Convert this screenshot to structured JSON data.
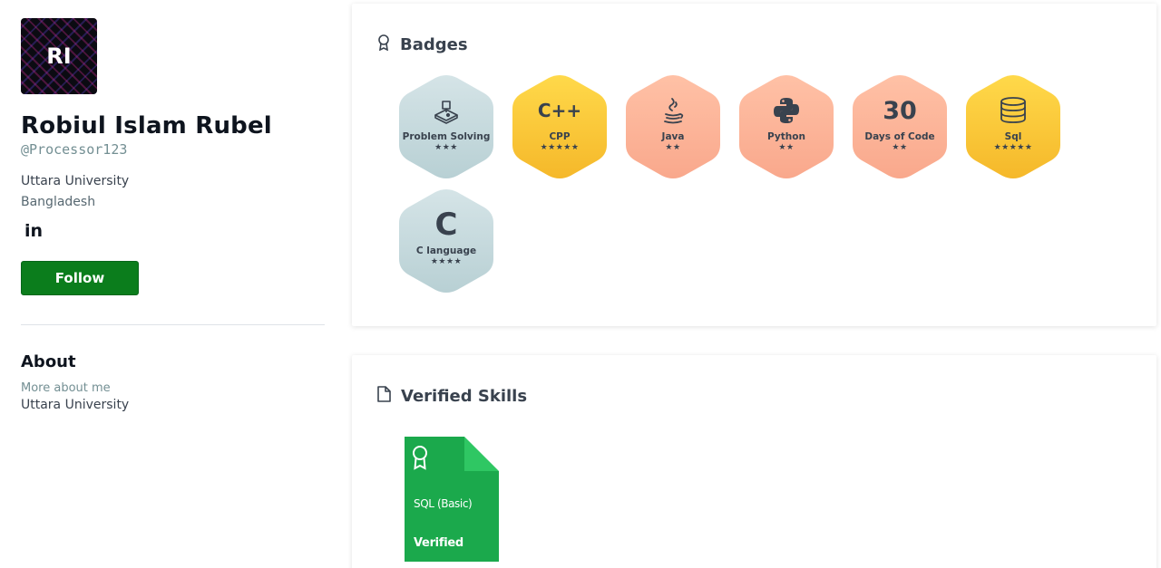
{
  "profile": {
    "avatar_initials": "RI",
    "name": "Robiul Islam Rubel",
    "handle": "@Processor123",
    "school": "Uttara University",
    "country": "Bangladesh",
    "linkedin_label": "in",
    "follow_label": "Follow"
  },
  "about": {
    "title": "About",
    "subtitle": "More about me",
    "school": "Uttara University"
  },
  "badges_section": {
    "title": "Badges",
    "items": [
      {
        "label": "Problem Solving",
        "stars": "★★★",
        "icon": "problem-solving-icon",
        "color": "silver"
      },
      {
        "label": "CPP",
        "stars": "★★★★★",
        "icon": "cpp-icon",
        "icon_text": "C++",
        "color": "gold"
      },
      {
        "label": "Java",
        "stars": "★★",
        "icon": "java-icon",
        "color": "bronze"
      },
      {
        "label": "Python",
        "stars": "★★",
        "icon": "python-icon",
        "color": "bronze"
      },
      {
        "label": "Days of Code",
        "stars": "★★",
        "icon": "days-of-code-icon",
        "icon_text": "30",
        "color": "bronze"
      },
      {
        "label": "Sql",
        "stars": "★★★★★",
        "icon": "database-icon",
        "color": "gold"
      },
      {
        "label": "C language",
        "stars": "★★★★",
        "icon": "c-icon",
        "icon_text": "C",
        "color": "silver"
      }
    ]
  },
  "skills_section": {
    "title": "Verified Skills",
    "items": [
      {
        "name": "SQL (Basic)",
        "status": "Verified"
      }
    ]
  },
  "colors": {
    "follow_green": "#0b7d1c",
    "skill_green": "#1ba94c",
    "gold_top": "#ffd94a",
    "gold_bottom": "#f5b82a",
    "bronze_top": "#ffc1a6",
    "bronze_bottom": "#f9a88c",
    "silver_top": "#d5e4e7",
    "silver_bottom": "#b8d0d4"
  }
}
